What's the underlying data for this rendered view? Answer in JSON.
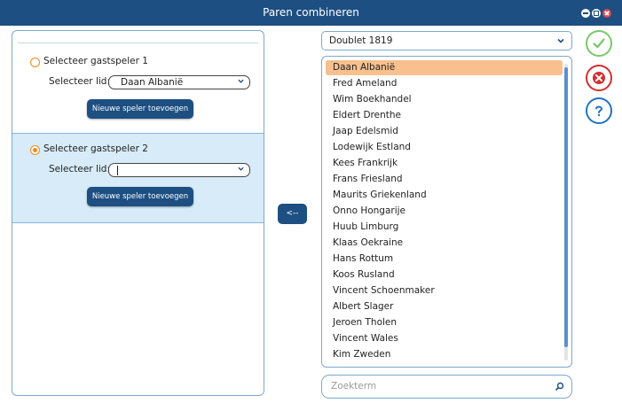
{
  "window": {
    "title": "Paren combineren"
  },
  "player1": {
    "radio_label": "Selecteer gastspeler 1",
    "member_label": "Selecteer lid:",
    "member_value": "Daan Albanië",
    "new_button": "Nieuwe speler toevoegen"
  },
  "player2": {
    "radio_label": "Selecteer gastspeler 2",
    "member_label": "Selecteer lid:",
    "member_value": "",
    "new_button": "Nieuwe speler toevoegen"
  },
  "transfer_button": "<--",
  "doublet": {
    "selected": "Doublet 1819"
  },
  "members": [
    "Daan Albanië",
    "Fred Ameland",
    "Wim Boekhandel",
    "Eldert Drenthe",
    "Jaap Edelsmid",
    "Lodewijk Estland",
    "Kees Frankrijk",
    "Frans Friesland",
    "Maurits Griekenland",
    "Onno Hongarije",
    "Huub Limburg",
    "Klaas Oekraine",
    "Hans Rottum",
    "Koos Rusland",
    "Vincent Schoenmaker",
    "Albert Slager",
    "Jeroen Tholen",
    "Vincent Wales",
    "Kim Zweden"
  ],
  "selected_member_index": 0,
  "search": {
    "placeholder": "Zoekterm"
  },
  "icons": {
    "ok": "check-icon",
    "cancel": "close-icon",
    "help": "question-icon",
    "search": "search-icon"
  },
  "colors": {
    "titlebar": "#1d4f82",
    "accent": "#f08a1c",
    "selected_row": "#f7c08e",
    "ok": "#78c96a",
    "cancel": "#d23030",
    "help": "#1f74c5"
  }
}
